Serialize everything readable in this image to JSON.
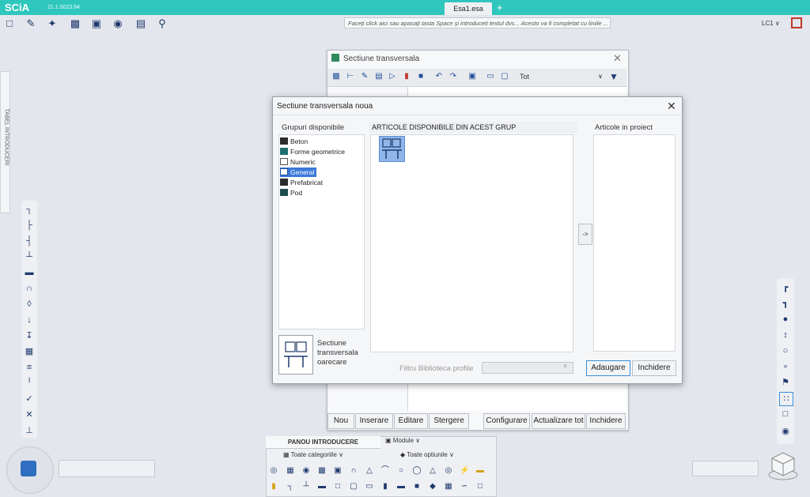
{
  "app": {
    "logo": "SCiA",
    "version": "21.1.0023.64",
    "active_tab": "Esa1.esa",
    "add_tab": "+"
  },
  "toolbar": {
    "command_placeholder": "Faceți click aici sau apasați tasta Space și introduceti textul dvs... Acesto va fi completat cu liniile ...",
    "load_case": "LC1"
  },
  "left_tab": {
    "label": "TABEL INTRODUCERI"
  },
  "background_window": {
    "title": "Sectiune transversala",
    "filter": "Tot",
    "buttons": [
      "Nou",
      "Inserare",
      "Editare",
      "Stergere",
      "Configurare",
      "Actualizare tot",
      "Inchidere"
    ]
  },
  "dialog": {
    "title": "Sectiune transversala noua",
    "groups_label": "Grupuri disponibile",
    "groups": [
      "Beton",
      "Forme geometrice",
      "Numeric",
      "General",
      "Prefabricat",
      "Pod"
    ],
    "selected_group": "General",
    "preview_caption": "Sectiune transversala oarecare",
    "items_header": "ARTICOLE DISPONIBILE DIN ACEST GRUP",
    "arrow_button": "->",
    "project_label": "Articole in proiect",
    "filter_label": "Filtru Biblioteca profile",
    "add_button": "Adaugare",
    "close_button": "Inchidere"
  },
  "bottom_panel": {
    "title": "PANOU INTRODUCERE",
    "modules": "Module",
    "categories": "Toate categoriile",
    "options": "Toate optiunile"
  },
  "colors": {
    "titlebar": "#2fc7bd",
    "selection": "#3b78d8",
    "accent_icon": "#1f3a6e",
    "delete_red": "#c0392b"
  }
}
